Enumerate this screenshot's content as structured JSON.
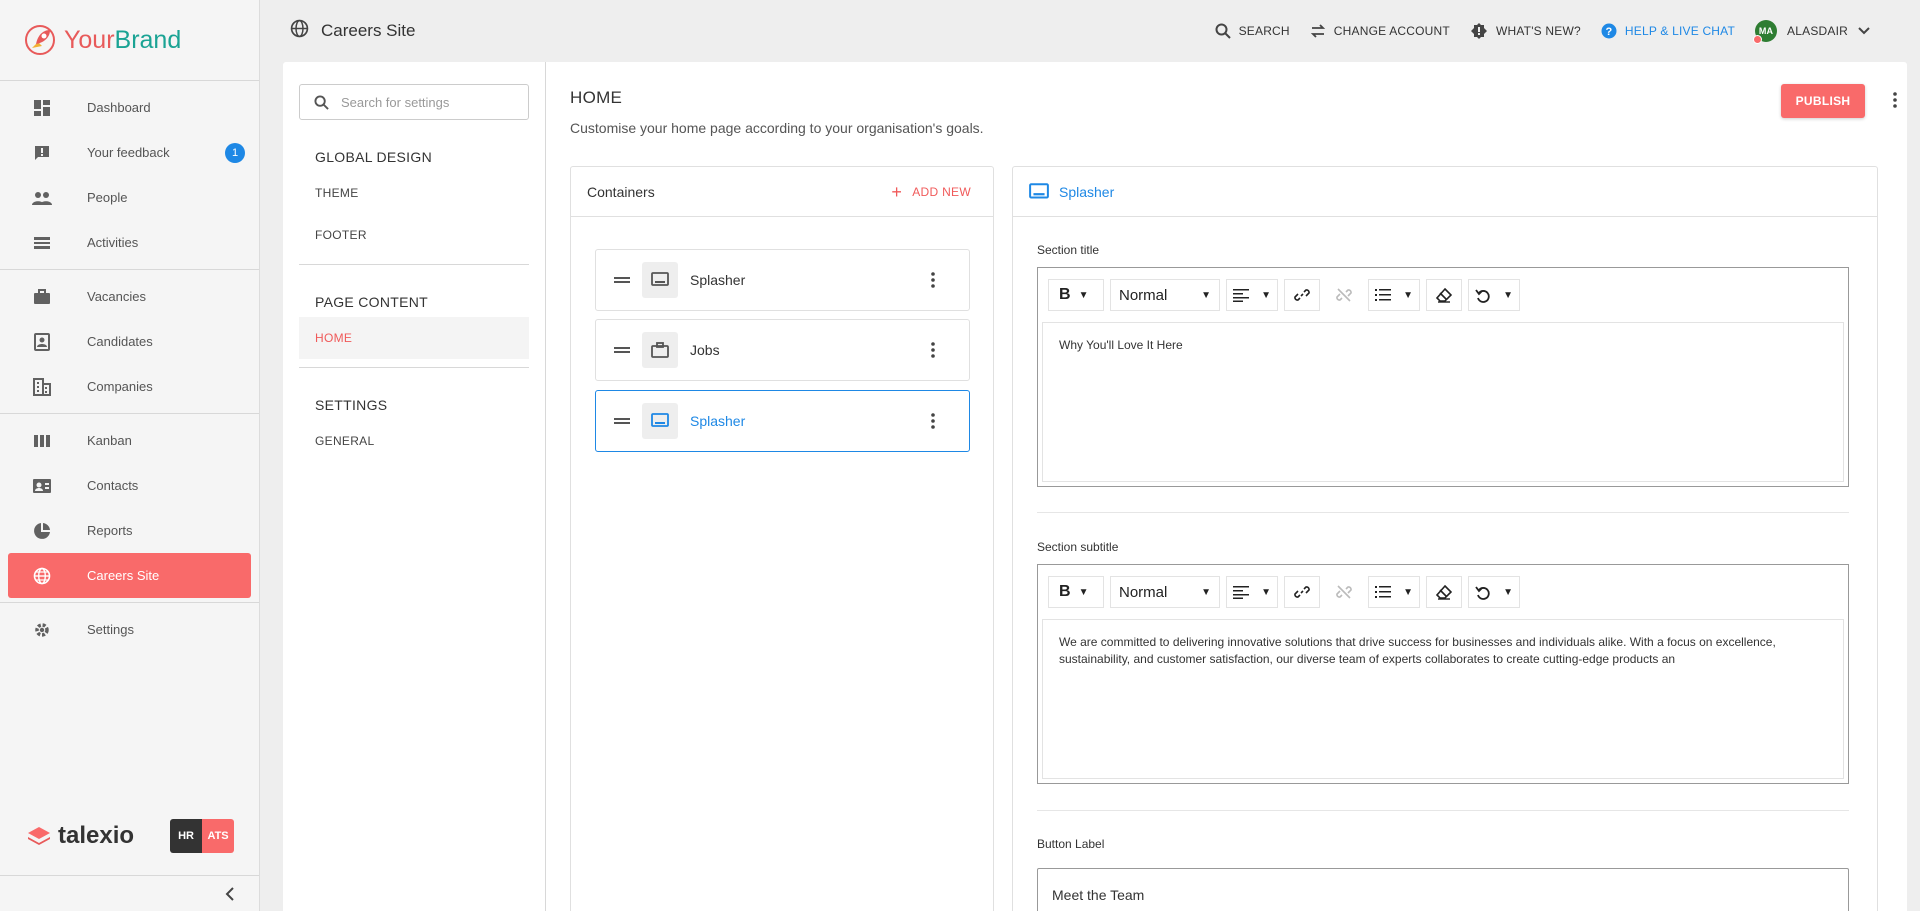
{
  "brand": {
    "part1": "Your",
    "part2": "Brand"
  },
  "sidebar": {
    "groups": [
      [
        {
          "label": "Dashboard",
          "icon": "dashboard-icon"
        },
        {
          "label": "Your feedback",
          "icon": "feedback-icon",
          "badge": "1"
        },
        {
          "label": "People",
          "icon": "people-icon"
        },
        {
          "label": "Activities",
          "icon": "activities-icon"
        }
      ],
      [
        {
          "label": "Vacancies",
          "icon": "briefcase-icon"
        },
        {
          "label": "Candidates",
          "icon": "candidate-icon"
        },
        {
          "label": "Companies",
          "icon": "building-icon"
        }
      ],
      [
        {
          "label": "Kanban",
          "icon": "kanban-icon"
        },
        {
          "label": "Contacts",
          "icon": "contacts-icon"
        },
        {
          "label": "Reports",
          "icon": "pie-chart-icon"
        },
        {
          "label": "Careers Site",
          "icon": "globe-icon",
          "active": true
        }
      ],
      [
        {
          "label": "Settings",
          "icon": "gear-icon"
        }
      ]
    ],
    "footer": {
      "logo": "talexio",
      "mode_hr": "HR",
      "mode_ats": "ATS"
    }
  },
  "topbar": {
    "title": "Careers Site",
    "search": "SEARCH",
    "change_account": "CHANGE ACCOUNT",
    "whats_new": "WHAT'S NEW?",
    "help": "HELP & LIVE CHAT",
    "avatar": "MA",
    "user": "ALASDAIR"
  },
  "settings_nav": {
    "search_placeholder": "Search for settings",
    "global_design": "GLOBAL DESIGN",
    "theme": "THEME",
    "footer": "FOOTER",
    "page_content": "PAGE CONTENT",
    "home": "HOME",
    "settings": "SETTINGS",
    "general": "GENERAL"
  },
  "content": {
    "title": "HOME",
    "subtitle": "Customise your home page according to your organisation's goals.",
    "publish": "PUBLISH",
    "containers": {
      "title": "Containers",
      "add_new": "ADD NEW",
      "items": [
        {
          "label": "Splasher",
          "icon": "monitor-icon"
        },
        {
          "label": "Jobs",
          "icon": "briefcase-icon"
        },
        {
          "label": "Splasher",
          "icon": "monitor-icon",
          "selected": true
        }
      ]
    },
    "editor": {
      "header": "Splasher",
      "section_title_label": "Section title",
      "section_title_value": "Why You'll Love It Here",
      "section_subtitle_label": "Section subtitle",
      "section_subtitle_value": "We are committed to delivering innovative solutions that drive success for businesses and individuals alike. With a focus on excellence, sustainability, and customer satisfaction, our diverse team of experts collaborates to create cutting-edge products an",
      "button_label_label": "Button Label",
      "button_label_value": "Meet the Team",
      "toolbar": {
        "bold": "B",
        "format": "Normal"
      }
    }
  },
  "colors": {
    "accent": "#f96a6a",
    "link": "#1e88e5",
    "brand_red": "#e85a5a",
    "brand_teal": "#1aa394"
  }
}
